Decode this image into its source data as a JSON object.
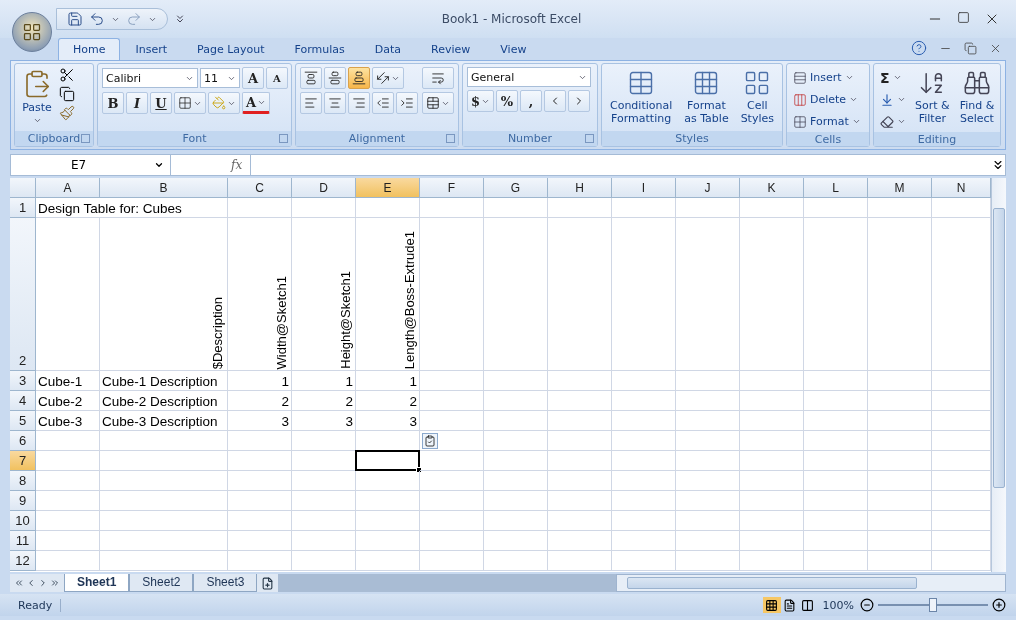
{
  "window": {
    "title": "Book1 - Microsoft Excel"
  },
  "ribbon_tabs": [
    {
      "label": "Home",
      "selected": true
    },
    {
      "label": "Insert",
      "selected": false
    },
    {
      "label": "Page Layout",
      "selected": false
    },
    {
      "label": "Formulas",
      "selected": false
    },
    {
      "label": "Data",
      "selected": false
    },
    {
      "label": "Review",
      "selected": false
    },
    {
      "label": "View",
      "selected": false
    }
  ],
  "clipboard": {
    "label": "Clipboard",
    "paste": "Paste"
  },
  "font": {
    "label": "Font",
    "name": "Calibri",
    "size": "11",
    "grow": "A",
    "shrink": "A",
    "bold": "B",
    "italic": "I",
    "underline": "U",
    "font_color_letter": "A"
  },
  "alignment": {
    "label": "Alignment",
    "vertical": [
      {
        "kind": "top",
        "selected": false
      },
      {
        "kind": "middle",
        "selected": false
      },
      {
        "kind": "bottom",
        "selected": true
      }
    ],
    "horizontal": [
      {
        "kind": "left",
        "selected": false
      },
      {
        "kind": "center",
        "selected": false
      },
      {
        "kind": "right",
        "selected": false
      }
    ]
  },
  "number": {
    "label": "Number",
    "format": "General",
    "currency": "$",
    "percent": "%",
    "comma": ","
  },
  "styles": {
    "label": "Styles",
    "buttons": [
      [
        "Conditional",
        "Formatting"
      ],
      [
        "Format",
        "as Table"
      ],
      [
        "Cell",
        "Styles"
      ]
    ]
  },
  "cells": {
    "label": "Cells",
    "buttons": [
      "Insert",
      "Delete",
      "Format"
    ]
  },
  "editing": {
    "label": "Editing",
    "sum": "Σ",
    "buttons": [
      [
        "Sort &",
        "Filter"
      ],
      [
        "Find &",
        "Select"
      ]
    ]
  },
  "formula_bar": {
    "name_box": "E7",
    "fx": "fx"
  },
  "sheet": {
    "columns": [
      {
        "label": "A",
        "selected": false
      },
      {
        "label": "B",
        "selected": false
      },
      {
        "label": "C",
        "selected": false
      },
      {
        "label": "D",
        "selected": false
      },
      {
        "label": "E",
        "selected": true
      },
      {
        "label": "F",
        "selected": false
      },
      {
        "label": "G",
        "selected": false
      },
      {
        "label": "H",
        "selected": false
      },
      {
        "label": "I",
        "selected": false
      },
      {
        "label": "J",
        "selected": false
      },
      {
        "label": "K",
        "selected": false
      },
      {
        "label": "L",
        "selected": false
      },
      {
        "label": "M",
        "selected": false
      },
      {
        "label": "N",
        "selected": false
      }
    ],
    "rows": [
      {
        "header": "1",
        "selected": false,
        "cells": [
          {
            "text": "Design Table for: Cubes"
          }
        ]
      },
      {
        "header": "2",
        "selected": false,
        "cells": [
          null,
          {
            "text": "$Description",
            "kind": "rotated"
          },
          {
            "text": "Width@Sketch1",
            "kind": "rotated"
          },
          {
            "text": "Height@Sketch1",
            "kind": "rotated"
          },
          {
            "text": "Length@Boss-Extrude1",
            "kind": "rotated"
          }
        ]
      },
      {
        "header": "3",
        "selected": false,
        "cells": [
          {
            "text": "Cube-1"
          },
          {
            "text": "Cube-1 Description"
          },
          {
            "text": "1",
            "kind": "number"
          },
          {
            "text": "1",
            "kind": "number"
          },
          {
            "text": "1",
            "kind": "number"
          }
        ]
      },
      {
        "header": "4",
        "selected": false,
        "cells": [
          {
            "text": "Cube-2"
          },
          {
            "text": "Cube-2 Description"
          },
          {
            "text": "2",
            "kind": "number"
          },
          {
            "text": "2",
            "kind": "number"
          },
          {
            "text": "2",
            "kind": "number"
          }
        ]
      },
      {
        "header": "5",
        "selected": false,
        "cells": [
          {
            "text": "Cube-3"
          },
          {
            "text": "Cube-3 Description"
          },
          {
            "text": "3",
            "kind": "number"
          },
          {
            "text": "3",
            "kind": "number"
          },
          {
            "text": "3",
            "kind": "number"
          }
        ]
      },
      {
        "header": "6",
        "selected": false
      },
      {
        "header": "7",
        "selected": true
      },
      {
        "header": "8",
        "selected": false
      },
      {
        "header": "9",
        "selected": false
      },
      {
        "header": "10",
        "selected": false
      },
      {
        "header": "11",
        "selected": false
      },
      {
        "header": "12",
        "selected": false
      }
    ]
  },
  "sheet_tabs": [
    {
      "label": "Sheet1",
      "selected": true
    },
    {
      "label": "Sheet2",
      "selected": false
    },
    {
      "label": "Sheet3",
      "selected": false
    }
  ],
  "status_bar": {
    "status": "Ready",
    "zoom": "100%",
    "zoom_slider": {
      "level": 0.5
    }
  }
}
